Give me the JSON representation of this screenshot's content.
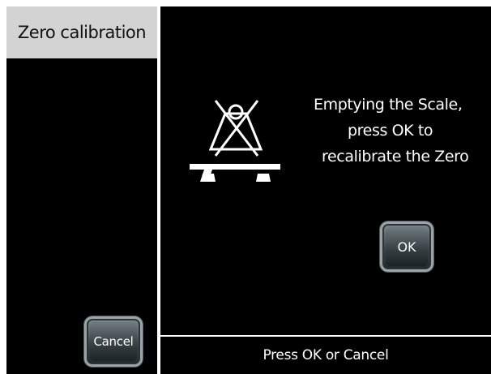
{
  "sidebar": {
    "title": "Zero calibration",
    "cancel_label": "Cancel"
  },
  "main": {
    "message_lines": [
      "Emptying the Scale,",
      "press OK to",
      "recalibrate the Zero"
    ],
    "ok_label": "OK",
    "icon": "scale-empty-icon"
  },
  "status": {
    "text": "Press OK or Cancel"
  },
  "colors": {
    "background": "#000000",
    "title_bar": "#d3d3d3",
    "text": "#ffffff",
    "button": "#3d4649"
  }
}
